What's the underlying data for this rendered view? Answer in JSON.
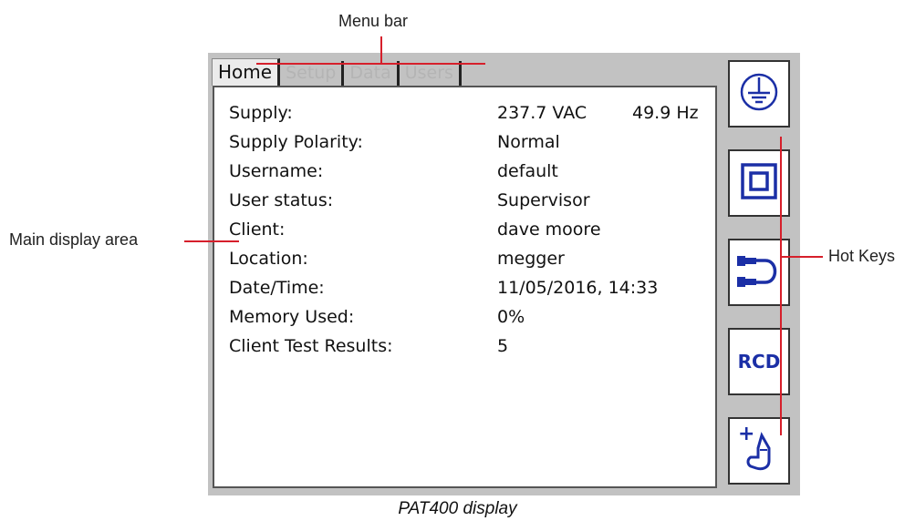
{
  "callouts": {
    "menu_bar": "Menu bar",
    "main_display_area": "Main display area",
    "hot_keys": "Hot Keys"
  },
  "caption": "PAT400 display",
  "tabs": [
    {
      "label": "Home",
      "active": true
    },
    {
      "label": "Setup",
      "active": false
    },
    {
      "label": "Data",
      "active": false
    },
    {
      "label": "Users",
      "active": false
    }
  ],
  "info": [
    {
      "label": "Supply:",
      "value": "237.7 VAC",
      "value2": "49.9 Hz"
    },
    {
      "label": "Supply Polarity:",
      "value": "Normal"
    },
    {
      "label": "Username:",
      "value": "default"
    },
    {
      "label": "User status:",
      "value": "Supervisor"
    },
    {
      "label": "Client:",
      "value": "dave moore"
    },
    {
      "label": "Location:",
      "value": "megger"
    },
    {
      "label": "Date/Time:",
      "value": "11/05/2016, 14:33"
    },
    {
      "label": "Memory Used:",
      "value": "0%"
    },
    {
      "label": "Client Test Results:",
      "value": "5"
    }
  ],
  "hotkeys": [
    {
      "icon": "earth-ground-icon"
    },
    {
      "icon": "double-insulation-icon"
    },
    {
      "icon": "lead-continuity-icon"
    },
    {
      "icon": "rcd-icon",
      "text": "RCD"
    },
    {
      "icon": "touch-current-probe-icon",
      "symbol": "+"
    }
  ],
  "colors": {
    "screen_bg": "#c2c2c2",
    "panel_bg": "#ffffff",
    "icon_blue": "#1b2fa6",
    "callout_line": "#d61f2b",
    "inactive_tab_text": "#b4b4b4"
  }
}
